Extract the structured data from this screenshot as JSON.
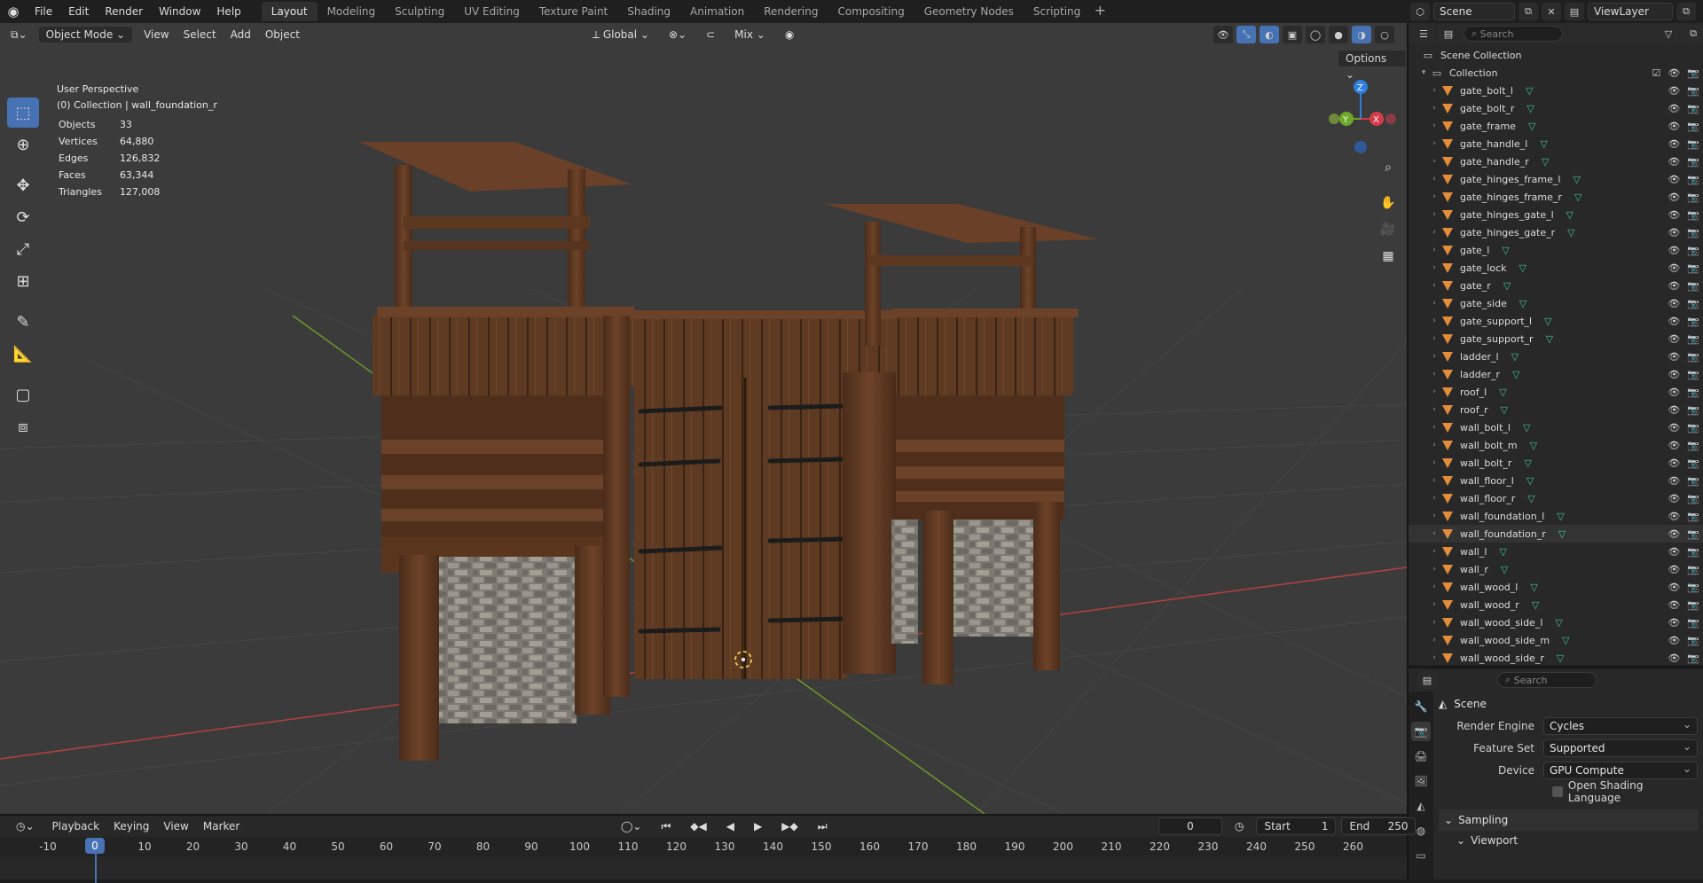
{
  "app": {
    "logo_icon": "blender-logo-icon"
  },
  "menu": [
    "File",
    "Edit",
    "Render",
    "Window",
    "Help"
  ],
  "workspaces": {
    "tabs": [
      "Layout",
      "Modeling",
      "Sculpting",
      "UV Editing",
      "Texture Paint",
      "Shading",
      "Animation",
      "Rendering",
      "Compositing",
      "Geometry Nodes",
      "Scripting"
    ],
    "active": "Layout",
    "add_label": "+"
  },
  "scene_selector": {
    "scene": "Scene",
    "view_layer": "ViewLayer"
  },
  "viewport_header": {
    "mode": "Object Mode",
    "menus": [
      "View",
      "Select",
      "Add",
      "Object"
    ],
    "transform_orientation": "Global",
    "snap_mode": "Mix",
    "options_label": "Options"
  },
  "viewport_overlay": {
    "perspective": "User Perspective",
    "context": "(0) Collection | wall_foundation_r",
    "stats": [
      {
        "label": "Objects",
        "value": "33"
      },
      {
        "label": "Vertices",
        "value": "64,880"
      },
      {
        "label": "Edges",
        "value": "126,832"
      },
      {
        "label": "Faces",
        "value": "63,344"
      },
      {
        "label": "Triangles",
        "value": "127,008"
      }
    ]
  },
  "gizmo": {
    "z": "Z",
    "y": "Y",
    "x": "X"
  },
  "colors": {
    "x_axis": "#d43c4a",
    "y_axis": "#6ea82a",
    "z_axis": "#2f7ee0",
    "selected": "#4772b3",
    "object_icon": "#e38d3b",
    "mesh_icon": "#3fc2a0"
  },
  "outliner": {
    "search_placeholder": "Search",
    "scene_collection": "Scene Collection",
    "collection": "Collection",
    "objects": [
      "gate_bolt_l",
      "gate_bolt_r",
      "gate_frame",
      "gate_handle_l",
      "gate_handle_r",
      "gate_hinges_frame_l",
      "gate_hinges_frame_r",
      "gate_hinges_gate_l",
      "gate_hinges_gate_r",
      "gate_l",
      "gate_lock",
      "gate_r",
      "gate_side",
      "gate_support_l",
      "gate_support_r",
      "ladder_l",
      "ladder_r",
      "roof_l",
      "roof_r",
      "wall_bolt_l",
      "wall_bolt_m",
      "wall_bolt_r",
      "wall_floor_l",
      "wall_floor_r",
      "wall_foundation_l",
      "wall_foundation_r",
      "wall_l",
      "wall_r",
      "wall_wood_l",
      "wall_wood_r",
      "wall_wood_side_l",
      "wall_wood_side_m",
      "wall_wood_side_r"
    ],
    "active_object": "wall_foundation_r"
  },
  "properties": {
    "search_placeholder": "Search",
    "title": "Scene",
    "render_engine_label": "Render Engine",
    "render_engine": "Cycles",
    "feature_set_label": "Feature Set",
    "feature_set": "Supported",
    "device_label": "Device",
    "device": "GPU Compute",
    "osl_label": "Open Shading Language",
    "sampling_label": "Sampling",
    "viewport_label": "Viewport"
  },
  "timeline": {
    "menus": [
      "Playback",
      "Keying",
      "View",
      "Marker"
    ],
    "current_frame": "0",
    "start_label": "Start",
    "start": "1",
    "end_label": "End",
    "end": "250",
    "ruler": [
      "-10",
      "0",
      "10",
      "20",
      "30",
      "40",
      "50",
      "60",
      "70",
      "80",
      "90",
      "100",
      "110",
      "120",
      "130",
      "140",
      "150",
      "160",
      "170",
      "180",
      "190",
      "200",
      "210",
      "220",
      "230",
      "240",
      "250",
      "260"
    ],
    "cursor": "0"
  }
}
